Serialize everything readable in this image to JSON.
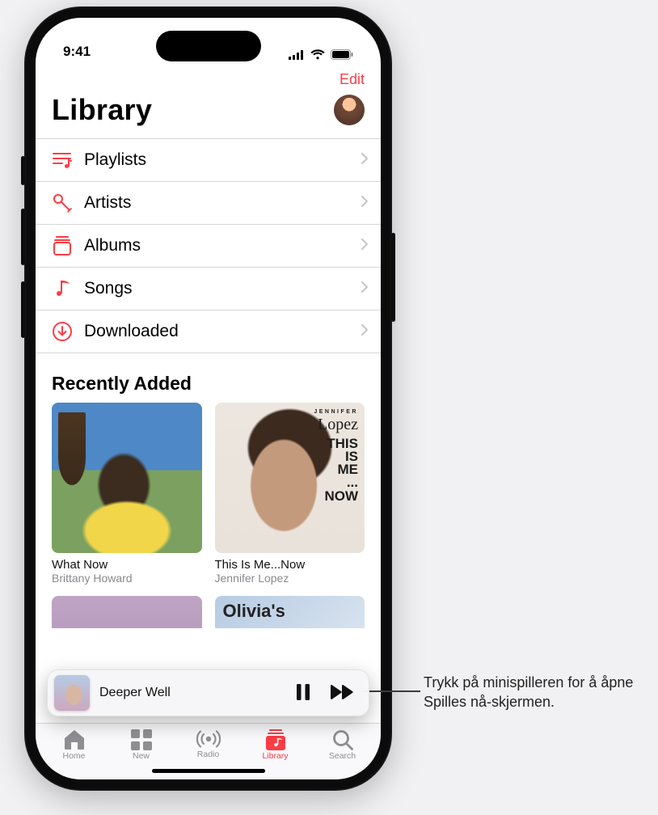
{
  "status": {
    "time": "9:41"
  },
  "nav": {
    "edit": "Edit"
  },
  "header": {
    "title": "Library"
  },
  "menu_items": [
    {
      "icon": "playlist-icon",
      "label": "Playlists"
    },
    {
      "icon": "microphone-icon",
      "label": "Artists"
    },
    {
      "icon": "album-stack-icon",
      "label": "Albums"
    },
    {
      "icon": "music-note-icon",
      "label": "Songs"
    },
    {
      "icon": "download-circle-icon",
      "label": "Downloaded"
    }
  ],
  "recently_added": {
    "title": "Recently Added",
    "items": [
      {
        "title": "What Now",
        "artist": "Brittany Howard"
      },
      {
        "title": "This Is Me...Now",
        "artist": "Jennifer Lopez"
      }
    ],
    "cover2": {
      "small": "JENNIFER",
      "script": "Lopez",
      "block": "THIS\nIS\nME\n...\nNOW"
    },
    "peek_title": "Olivia's"
  },
  "miniplayer": {
    "track": "Deeper Well"
  },
  "tabs": [
    {
      "label": "Home"
    },
    {
      "label": "New"
    },
    {
      "label": "Radio"
    },
    {
      "label": "Library"
    },
    {
      "label": "Search"
    }
  ],
  "callout": "Trykk på minispilleren for å åpne Spilles nå-skjermen.",
  "colors": {
    "accent": "#fc3c44"
  }
}
